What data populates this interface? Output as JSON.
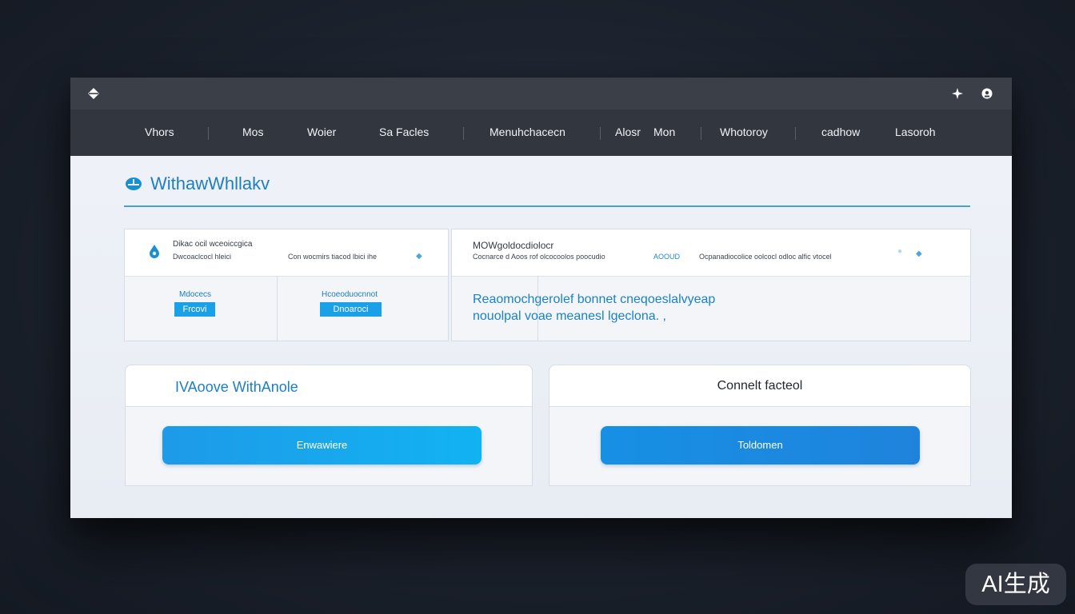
{
  "nav": {
    "items": [
      "Vhors",
      "Mos",
      "Woier",
      "Sa Facles",
      "Menuhchacecn",
      "Alosr",
      "Mon",
      "Whotoroy",
      "cadhow",
      "Lasoroh"
    ]
  },
  "page": {
    "title": "WithawWhllakv"
  },
  "panel_left": {
    "header_line1": "Dikac ocil wceoiccgica",
    "header_line2": "Dwcoaclcocl hleici",
    "header_note": "Con wocmirs tiacod lbici ihe",
    "chip1_label": "Mdocecs",
    "chip1_value": "Frcovi",
    "chip2_label": "Hcoeoduocnnot",
    "chip2_value": "Dnoaroci"
  },
  "panel_right": {
    "header_line1": "MOWgoldocdiolocr",
    "header_line2": "Cocnarce d Aoos rof olcocoolos poocudio",
    "header_link": "AOOUD",
    "header_note": "Ocpanadiocolice oolcocl odloc alfic vtocel",
    "desc_line1": "Reaomochgerolef bonnet cneqoeslalvyeap",
    "desc_line2": "nouolpal voae meanesl lgeclona. ,"
  },
  "card_left": {
    "title": "IVAoove WithAnole",
    "button_label": "Enwawiere"
  },
  "card_right": {
    "title": "Connelt facteol",
    "button_label": "Toldomen"
  },
  "watermark": {
    "text": "AI生成"
  },
  "colors": {
    "accent": "#1aa0e6",
    "title_blue": "#1f7fbe",
    "nav_bg": "#31363f",
    "titlebar_bg": "#3a3f48"
  }
}
